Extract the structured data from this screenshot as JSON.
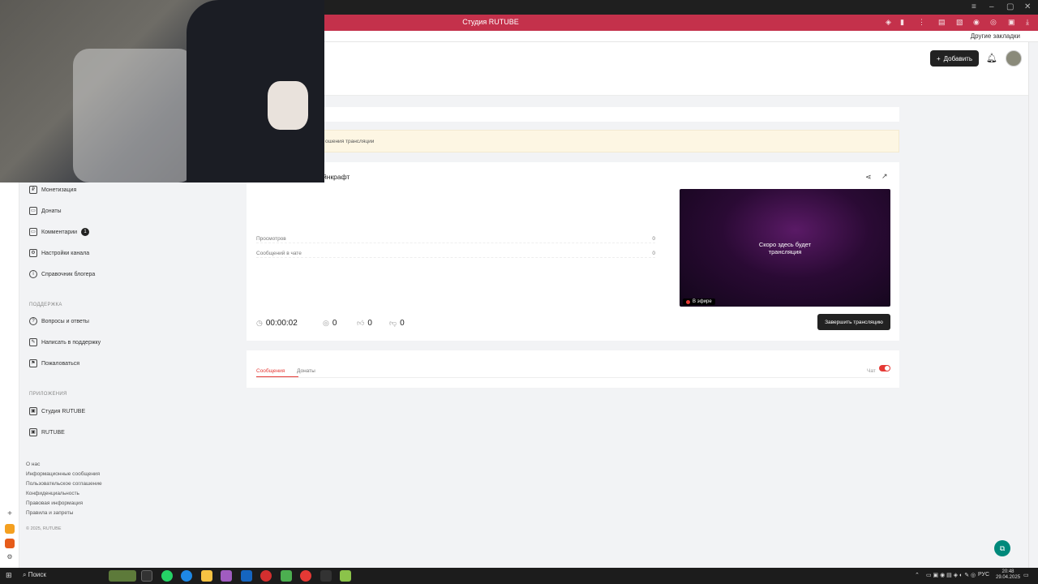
{
  "window": {
    "minimize": "–",
    "maximize": "▢",
    "close": "✕"
  },
  "browser": {
    "title": "Студия RUTUBE",
    "other_bookmarks": "Другие закладки"
  },
  "header": {
    "add_button": "Добавить"
  },
  "sidebar": {
    "items": [
      {
        "label": "Монетизация",
        "icon": "₽"
      },
      {
        "label": "Донаты",
        "icon": "▭"
      },
      {
        "label": "Комментарии",
        "icon": "▭",
        "badge": "1"
      },
      {
        "label": "Настройки канала",
        "icon": "⚙"
      },
      {
        "label": "Справочник блогера",
        "icon": "i"
      }
    ],
    "support_heading": "ПОДДЕРЖКА",
    "support_items": [
      {
        "label": "Вопросы и ответы",
        "icon": "?"
      },
      {
        "label": "Написать в поддержку",
        "icon": "✎"
      },
      {
        "label": "Пожаловаться",
        "icon": "⚑"
      }
    ],
    "apps_heading": "ПРИЛОЖЕНИЯ",
    "apps_items": [
      {
        "label": "Студия RUTUBE",
        "icon": "▣"
      },
      {
        "label": "RUTUBE",
        "icon": "▣"
      }
    ],
    "footer_links": [
      "О нас",
      "Информационные сообщения",
      "Пользовательское соглашение",
      "Конфиденциальность",
      "Правовая информация",
      "Правила и запреты"
    ],
    "copyright": "© 2025, RUTUBE"
  },
  "notice": {
    "text": "ошения трансляции"
  },
  "stream": {
    "title": "йнкрафт",
    "stats": [
      {
        "label": "Просмотров",
        "value": "0"
      },
      {
        "label": "Сообщений в чате",
        "value": "0"
      }
    ],
    "preview_line1": "Скоро здесь будет",
    "preview_line2": "трансляция",
    "live_label": "В эфире",
    "duration": "00:00:02",
    "viewers": "0",
    "likes": "0",
    "dislikes": "0",
    "end_button": "Завершить трансляцию"
  },
  "tabs": {
    "messages": "Сообщения",
    "donations": "Донаты",
    "chat_label": "Чат"
  },
  "taskbar": {
    "search": "Поиск",
    "lang": "РУС",
    "time": "20:48",
    "date": "29.04.2025"
  },
  "colors": {
    "brand": "#c4314b",
    "accent": "#e53935",
    "help": "#00897b"
  }
}
